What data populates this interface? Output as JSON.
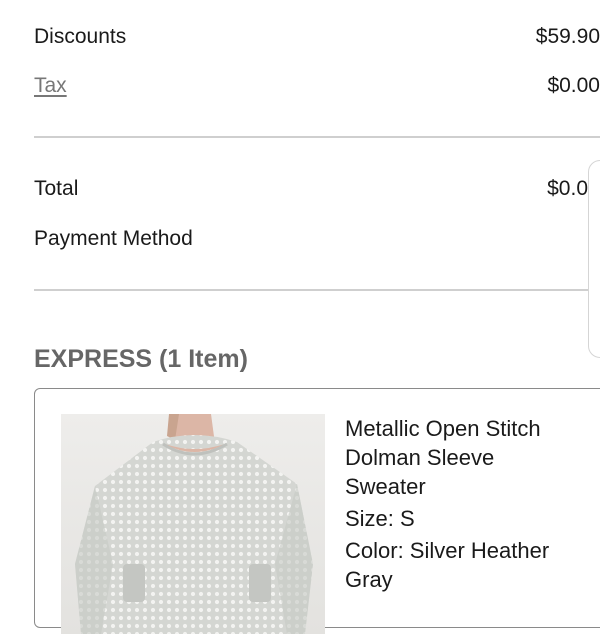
{
  "summary": {
    "discounts": {
      "label": "Discounts",
      "amount": "$59.90"
    },
    "tax": {
      "label": "Tax",
      "amount": "$0.00"
    },
    "total": {
      "label": "Total",
      "amount": "$0.0"
    },
    "payment_method": {
      "label": "Payment Method"
    }
  },
  "order": {
    "heading": "EXPRESS (1 Item)",
    "items": [
      {
        "name": "Metallic Open Stitch Dolman Sleeve Sweater",
        "size": "Size: S",
        "color": "Color: Silver Heather Gray"
      }
    ]
  },
  "colors": {
    "divider": "#cfcfcf",
    "muted_text": "#777777",
    "heading_text": "#666666",
    "card_border": "#8a8a8a",
    "sweater": "#cfd1cd"
  }
}
